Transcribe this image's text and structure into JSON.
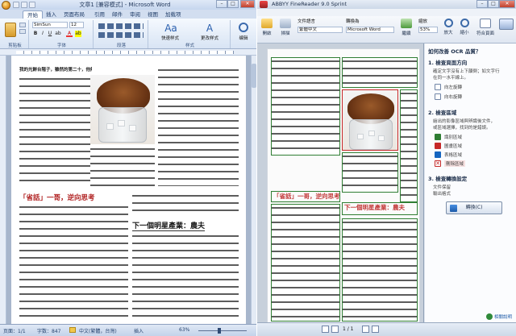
{
  "word": {
    "title": "文章1 [兼容模式] - Microsoft Word",
    "tabs": [
      "开始",
      "插入",
      "页面布局",
      "引用",
      "邮件",
      "审阅",
      "视图",
      "加载项"
    ],
    "ribbon": {
      "font_name": "SimSun",
      "font_size": "12",
      "groups": {
        "clipboard": "剪贴板",
        "font": "字体",
        "paragraph": "段落",
        "styles": "样式",
        "editing": "编辑"
      },
      "quick_styles": "快速样式",
      "change_styles": "更改样式",
      "editing_btn": "编辑"
    },
    "document": {
      "heading1": "「省話」一哥，逆向思考",
      "heading2": "下一個明星產業：農夫",
      "intro": "我的光鮮台階子，雖然的第二十，他無，"
    },
    "status": {
      "page": "页面：1/1",
      "words": "字数：847",
      "language": "中文(繁體，台灣)",
      "mode": "插入",
      "zoom": "63%"
    }
  },
  "finereader": {
    "title": "ABBYY FineReader 9.0 Sprint",
    "toolbar": {
      "language_label": "文件語言",
      "language_value": "繁體中文",
      "send_label": "轉換為",
      "send_value": "Microsoft Word",
      "next_label": "繼續",
      "zoom_label": "縮放",
      "zoom_value": "53%",
      "pages_label": "頁",
      "btn_read": "讀取",
      "btn_zoom_in": "放大",
      "btn_zoom_out": "縮小",
      "btn_fit": "符合頁面",
      "btn_open": "開啟",
      "btn_scan": "掃描"
    },
    "task_pane": {
      "title": "如何改善 OCR 品質？",
      "step1_title": "1. 檢查頁面方向",
      "step1_text1": "確定文字沒有上下顛倒；如文字行",
      "step1_text2": "在同一水平線上。",
      "rotate_left": "向左旋轉",
      "rotate_right": "向右旋轉",
      "step2_title": "2. 檢查區域",
      "step2_text1": "繪出的影像區域與辨識後文件，",
      "step2_text2": "或區域選擇，找到的是錯誤。",
      "zone_text": "識別區域",
      "zone_picture": "圖畫區域",
      "zone_table": "表格區域",
      "zone_delete": "刪除區域",
      "step3_title": "3. 檢查轉換設定",
      "step3_text1": "文件保留",
      "step3_text2": "輸出格式",
      "convert_btn": "轉換(C)",
      "help": "相關說明"
    },
    "page_indicator": "1 / 1"
  },
  "colors": {
    "word_accent": "#dbe6f4",
    "heading_red": "#b02020",
    "zone_text": "#2e7d32",
    "zone_picture": "#c62828",
    "zone_table": "#1565c0",
    "zone_delete": "#c62828"
  },
  "icons": [
    "office-orb-icon",
    "save-icon",
    "undo-icon",
    "paste-icon",
    "bold-icon",
    "italic-icon",
    "underline-icon",
    "rotate-left-icon",
    "rotate-right-icon",
    "zoom-in-icon",
    "zoom-out-icon",
    "scan-icon",
    "open-icon",
    "convert-icon",
    "help-icon"
  ]
}
